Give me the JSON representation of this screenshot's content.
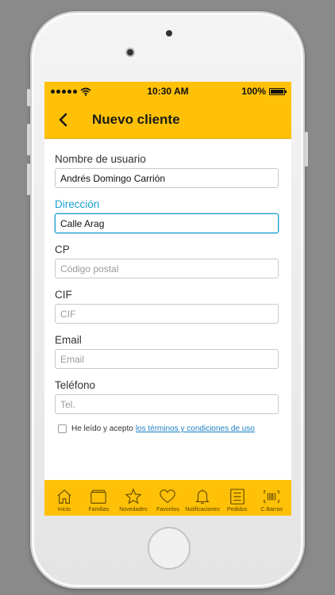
{
  "status_bar": {
    "time": "10:30 AM",
    "battery": "100%",
    "battery_level": 1.0
  },
  "nav": {
    "title": "Nuevo cliente"
  },
  "form": {
    "fields": [
      {
        "label": "Nombre de usuario",
        "value": "Andrés Domingo Carrión",
        "placeholder": ""
      },
      {
        "label": "Dirección",
        "value": "Calle Arag",
        "placeholder": ""
      },
      {
        "label": "CP",
        "value": "",
        "placeholder": "Código postal"
      },
      {
        "label": "CIF",
        "value": "",
        "placeholder": "CIF"
      },
      {
        "label": "Email",
        "value": "",
        "placeholder": "Email"
      },
      {
        "label": "Teléfono",
        "value": "",
        "placeholder": "Tel."
      }
    ],
    "terms_text": "He leído y acepto",
    "terms_link": "los términos y condiciones de uso"
  },
  "tabs": [
    {
      "label": "Inicio",
      "icon": "home-icon"
    },
    {
      "label": "Familias",
      "icon": "folder-icon"
    },
    {
      "label": "Novedades",
      "icon": "star-icon"
    },
    {
      "label": "Favoritos",
      "icon": "heart-icon"
    },
    {
      "label": "Notificaciones",
      "icon": "bell-icon"
    },
    {
      "label": "Pedidos",
      "icon": "list-icon"
    },
    {
      "label": "C.Barras",
      "icon": "barcode-icon"
    }
  ],
  "colors": {
    "accent": "#ffc107",
    "focus": "#1b9fd1",
    "link": "#1b7fc4"
  }
}
